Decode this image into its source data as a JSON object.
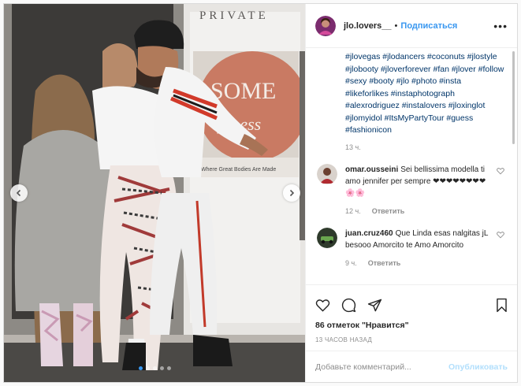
{
  "post": {
    "header": {
      "username": "jlo.lovers__",
      "separator": "•",
      "follow_label": "Подписаться",
      "more_label": "•••"
    },
    "photo": {
      "sign_text": "PRIVATE",
      "banner_word_1": "SOME",
      "banner_word_2": "fitness",
      "banner_tagline": "Where Great Bodies Are Made",
      "dots_count": 5,
      "active_dot": 0
    },
    "caption": {
      "hashtags": "#jlovegas #jlodancers #coconuts #jlostyle #jlobooty #jloverforever #fan #jlover #follow #sexy #booty #jlo #photo #insta #likeforlikes #instaphotograph #alexrodriguez #instalovers #jloxinglot #jlomyidol #ItsMyPartyTour #guess #fashionicon",
      "time": "13 ч."
    },
    "comments": [
      {
        "username": "omar.ousseini",
        "text": "Sei bellissima modella ti amo jennifer per sempre ❤❤❤❤❤❤❤❤🌸🌸",
        "time": "12 ч.",
        "reply_label": "Ответить"
      },
      {
        "username": "juan.cruz460",
        "text": "Que Linda esas nalgitas jL besooo Amorcito te Amo Amorcito",
        "time": "9 ч.",
        "reply_label": "Ответить"
      }
    ],
    "likes_text": "86 отметок \"Нравится\"",
    "posted_ago": "13 ЧАСОВ НАЗАД",
    "add_comment": {
      "placeholder": "Добавьте комментарий...",
      "publish_label": "Опубликовать"
    },
    "colors": {
      "accent": "#3897f0",
      "hashtag": "#003569",
      "muted": "#8e8e8e",
      "publish_disabled": "#b2dffc"
    }
  }
}
